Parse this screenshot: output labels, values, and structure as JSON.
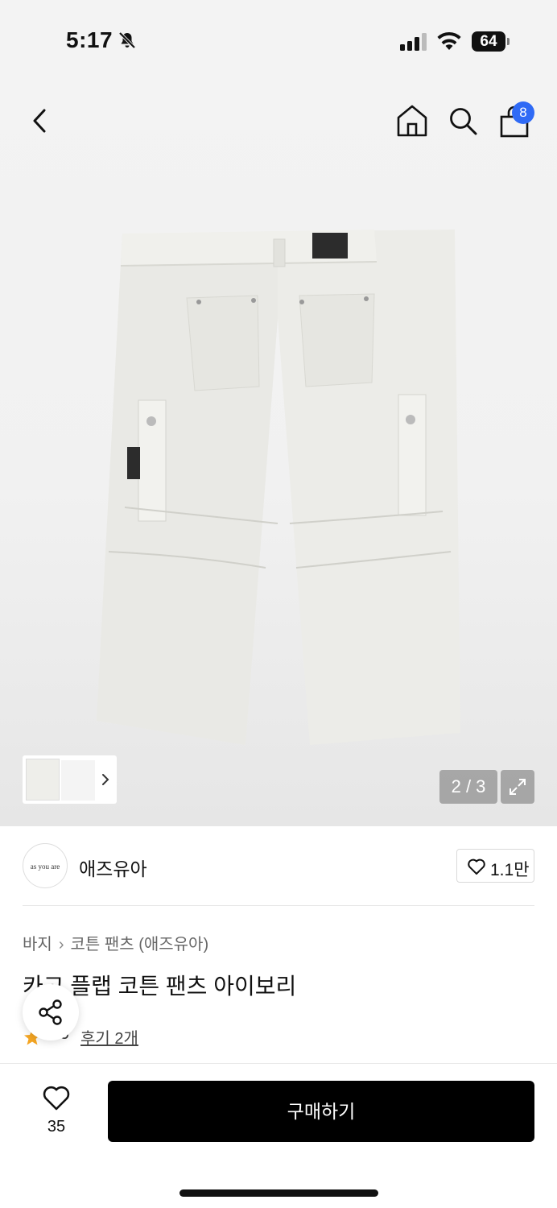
{
  "status_bar": {
    "time": "5:17",
    "battery": "64"
  },
  "header": {
    "cart_count": "8"
  },
  "gallery": {
    "page_indicator": "2 / 3"
  },
  "brand": {
    "logo_text": "as you are",
    "name": "애즈유아",
    "like_count": "1.1만"
  },
  "breadcrumb": {
    "category": "바지",
    "subcategory": "코튼 팬츠 (애즈유아)"
  },
  "product": {
    "title": "카고 플랩 코튼 팬츠 아이보리"
  },
  "rating": {
    "value": "4.5",
    "reviews_label": "후기 2개"
  },
  "bottom_bar": {
    "like_count": "35",
    "buy_label": "구매하기"
  },
  "colors": {
    "accent_blue": "#2f6af5",
    "star_orange": "#f5a623",
    "buy_button": "#000000"
  }
}
